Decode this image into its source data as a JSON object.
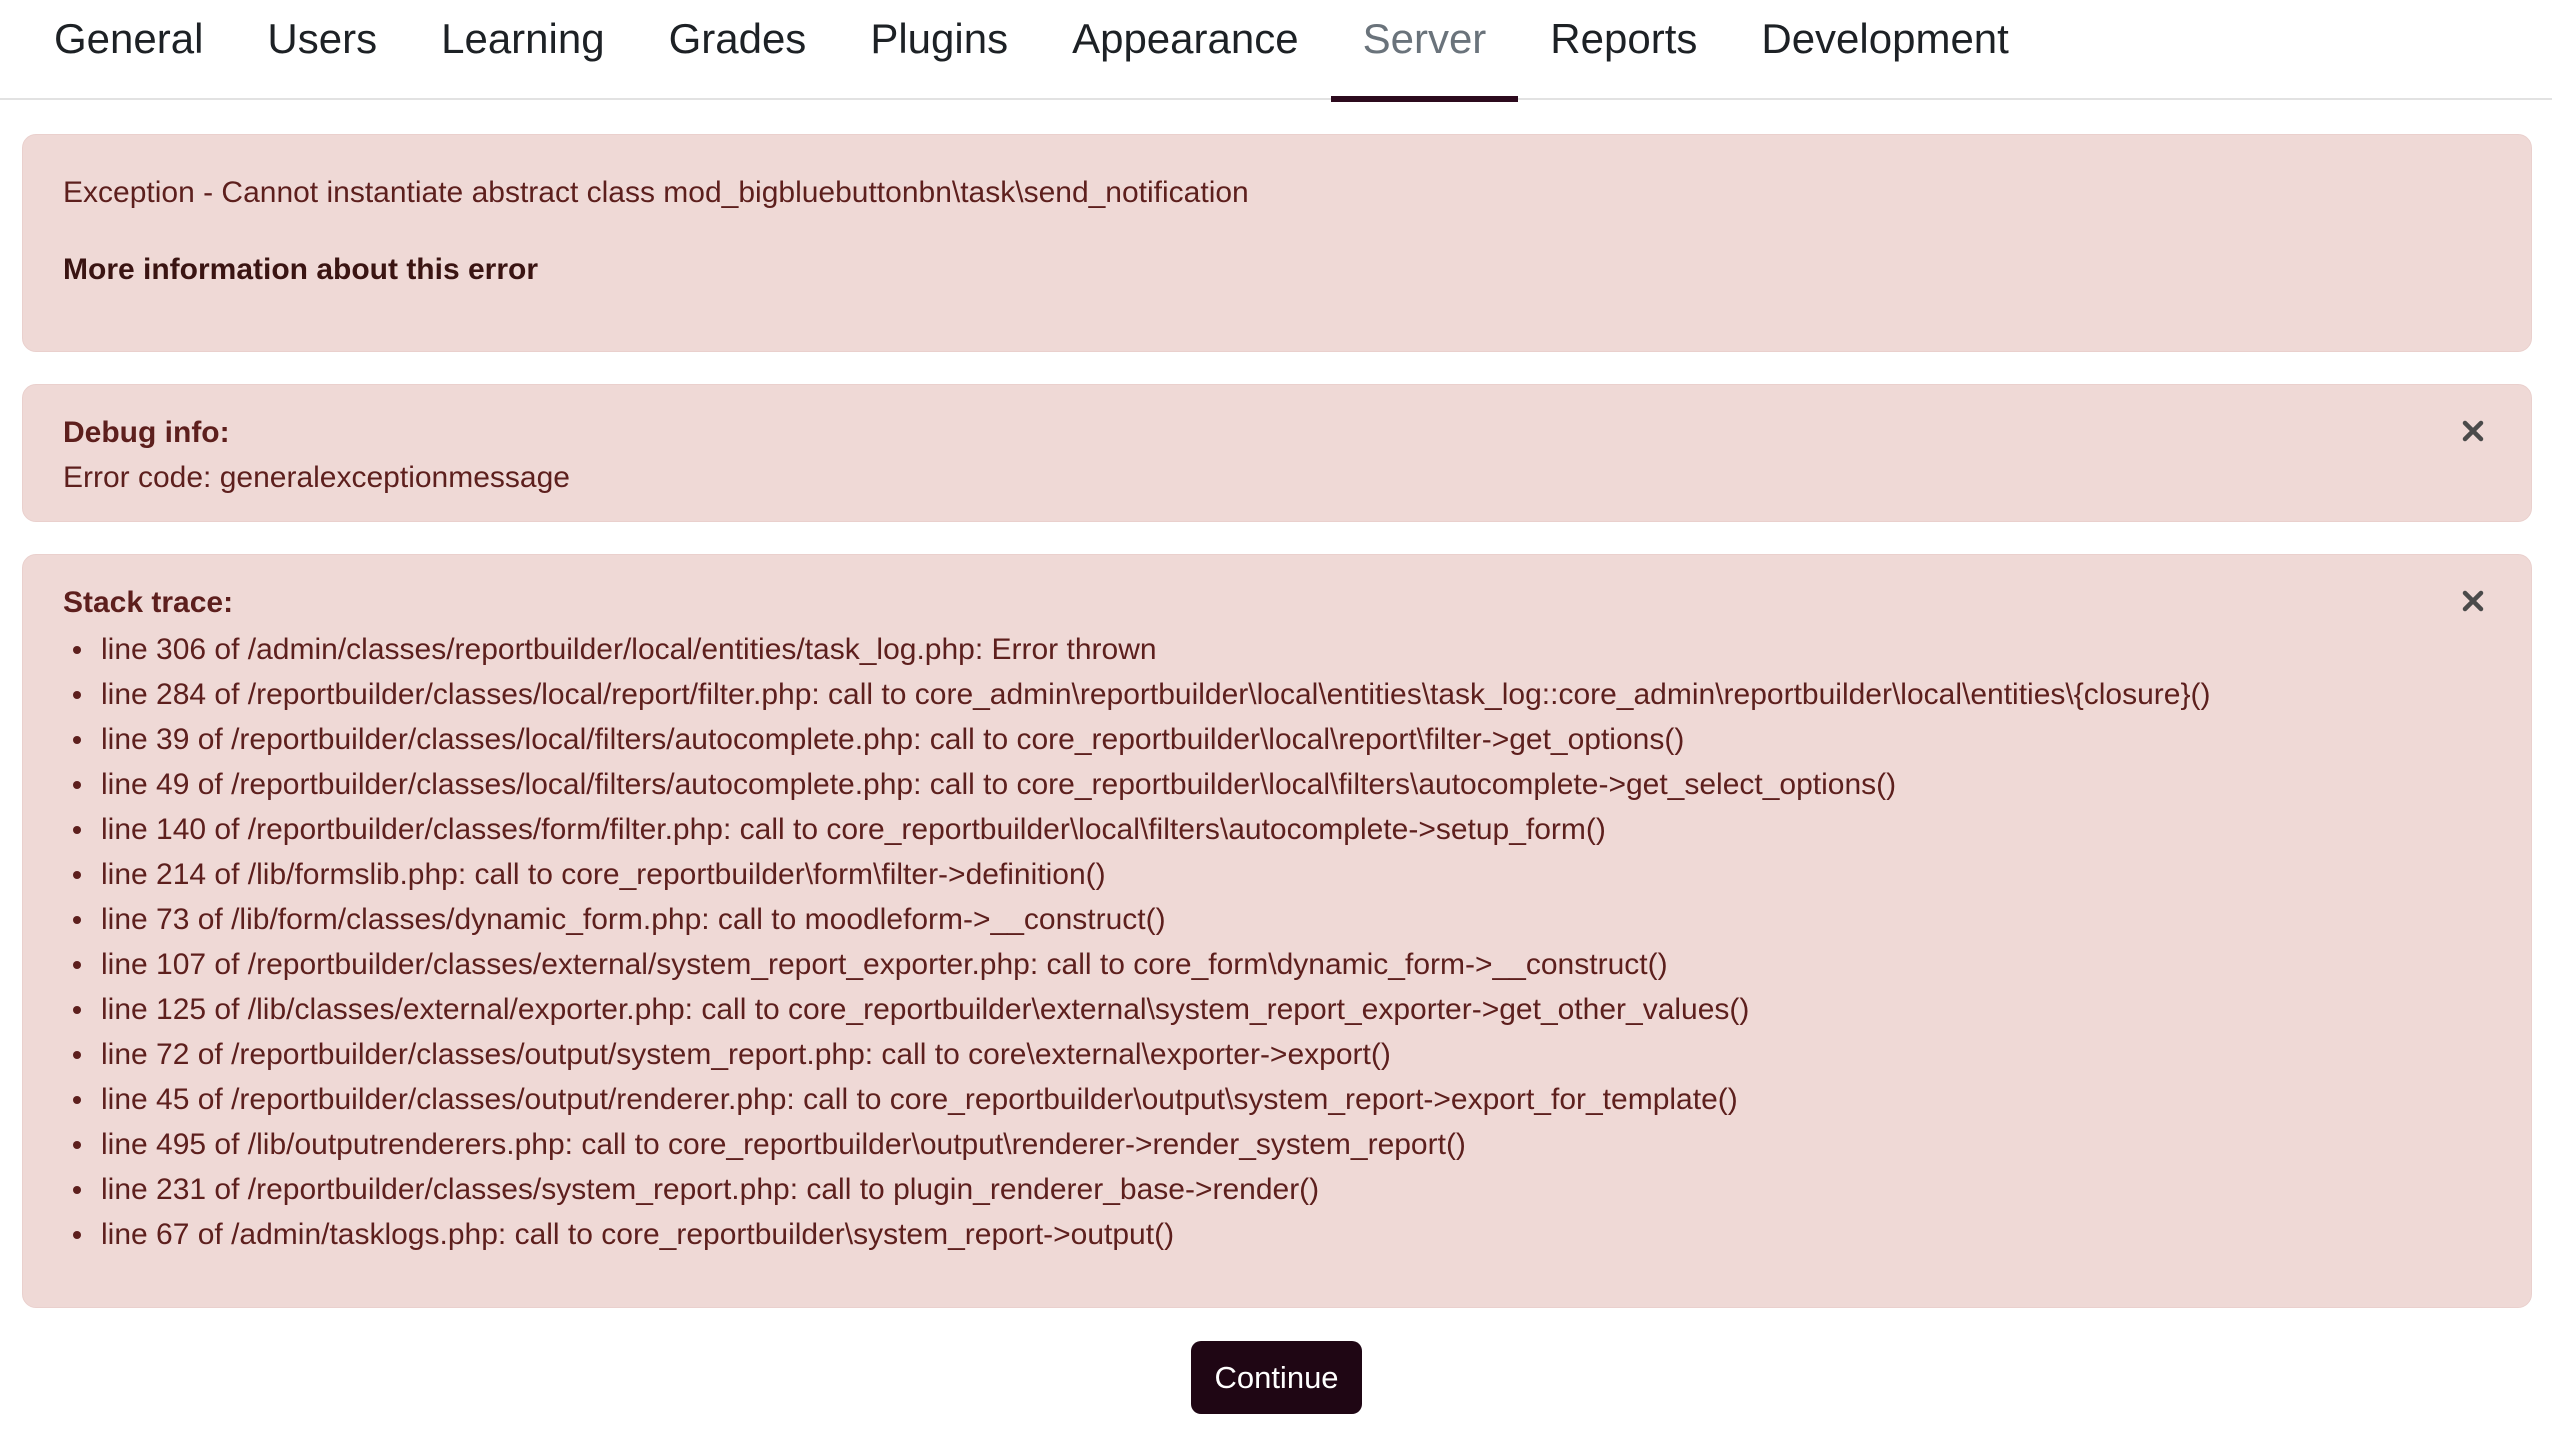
{
  "nav": {
    "tabs": [
      {
        "label": "General"
      },
      {
        "label": "Users"
      },
      {
        "label": "Learning"
      },
      {
        "label": "Grades"
      },
      {
        "label": "Plugins"
      },
      {
        "label": "Appearance"
      },
      {
        "label": "Server",
        "active": true
      },
      {
        "label": "Reports"
      },
      {
        "label": "Development"
      }
    ]
  },
  "error": {
    "message": "Exception - Cannot instantiate abstract class mod_bigbluebuttonbn\\task\\send_notification",
    "more_info": "More information about this error"
  },
  "debug": {
    "title": "Debug info:",
    "code": "Error code: generalexceptionmessage",
    "close_icon": "close-icon"
  },
  "trace": {
    "title": "Stack trace:",
    "close_icon": "close-icon",
    "lines": [
      "line 306 of /admin/classes/reportbuilder/local/entities/task_log.php: Error thrown",
      "line 284 of /reportbuilder/classes/local/report/filter.php: call to core_admin\\reportbuilder\\local\\entities\\task_log::core_admin\\reportbuilder\\local\\entities\\{closure}()",
      "line 39 of /reportbuilder/classes/local/filters/autocomplete.php: call to core_reportbuilder\\local\\report\\filter->get_options()",
      "line 49 of /reportbuilder/classes/local/filters/autocomplete.php: call to core_reportbuilder\\local\\filters\\autocomplete->get_select_options()",
      "line 140 of /reportbuilder/classes/form/filter.php: call to core_reportbuilder\\local\\filters\\autocomplete->setup_form()",
      "line 214 of /lib/formslib.php: call to core_reportbuilder\\form\\filter->definition()",
      "line 73 of /lib/form/classes/dynamic_form.php: call to moodleform->__construct()",
      "line 107 of /reportbuilder/classes/external/system_report_exporter.php: call to core_form\\dynamic_form->__construct()",
      "line 125 of /lib/classes/external/exporter.php: call to core_reportbuilder\\external\\system_report_exporter->get_other_values()",
      "line 72 of /reportbuilder/classes/output/system_report.php: call to core\\external\\exporter->export()",
      "line 45 of /reportbuilder/classes/output/renderer.php: call to core_reportbuilder\\output\\system_report->export_for_template()",
      "line 495 of /lib/outputrenderers.php: call to core_reportbuilder\\output\\renderer->render_system_report()",
      "line 231 of /reportbuilder/classes/system_report.php: call to plugin_renderer_base->render()",
      "line 67 of /admin/tasklogs.php: call to core_reportbuilder\\system_report->output()"
    ]
  },
  "continue_label": "Continue",
  "colors": {
    "alert_bg": "#efd9d6",
    "alert_text": "#5d1f1d",
    "button_bg": "#1f0614",
    "active_tab_underline": "#2c0a1d"
  }
}
